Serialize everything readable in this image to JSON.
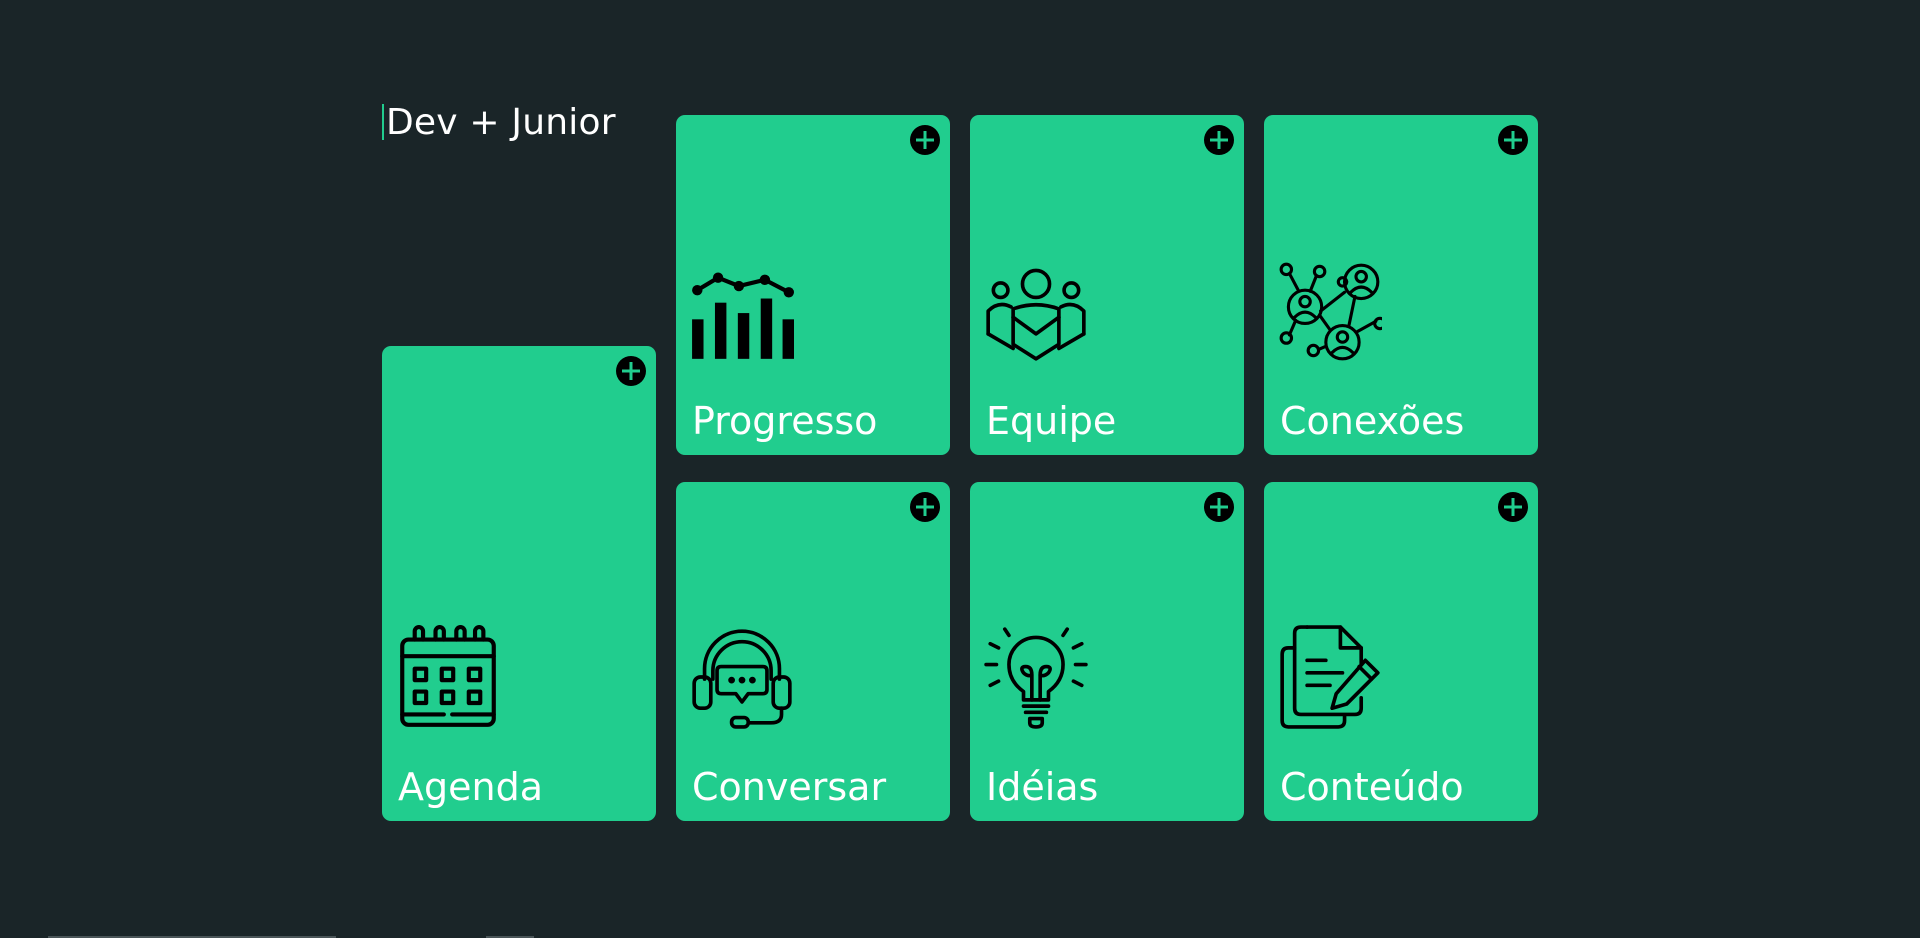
{
  "brand": {
    "title": "Dev + Junior"
  },
  "colors": {
    "background": "#1a2528",
    "card": "#21cd8e",
    "text": "#ffffff",
    "icon": "#000000"
  },
  "cards": [
    {
      "label": "Agenda",
      "icon": "calendar-icon"
    },
    {
      "label": "Progresso",
      "icon": "bar-chart-icon"
    },
    {
      "label": "Equipe",
      "icon": "team-icon"
    },
    {
      "label": "Conexões",
      "icon": "network-icon"
    },
    {
      "label": "Conversar",
      "icon": "headset-chat-icon"
    },
    {
      "label": "Idéias",
      "icon": "lightbulb-icon"
    },
    {
      "label": "Conteúdo",
      "icon": "documents-pencil-icon"
    }
  ]
}
